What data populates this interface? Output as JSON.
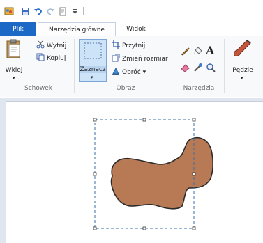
{
  "tabs": {
    "file": "Plik",
    "home": "Narzędzia główne",
    "view": "Widok"
  },
  "clipboard": {
    "paste": "Wklej",
    "cut": "Wytnij",
    "copy": "Kopiuj",
    "group": "Schowek"
  },
  "image": {
    "select": "Zaznacz",
    "crop": "Przytnij",
    "resize": "Zmień rozmiar",
    "rotate": "Obróć ▾",
    "group": "Obraz"
  },
  "tools": {
    "group": "Narzędzia",
    "text_glyph": "A"
  },
  "brushes": {
    "label": "Pędzle"
  },
  "colors": {
    "accent": "#1b68c7",
    "shape_fill": "#b87955",
    "shape_stroke": "#2b2b2b",
    "selection": "#3b6ea5"
  },
  "icons": [
    "app-icon",
    "save-icon",
    "undo-icon",
    "redo-icon",
    "customize-icon",
    "paste-icon",
    "cut-icon",
    "copy-icon",
    "select-icon",
    "crop-icon",
    "resize-icon",
    "rotate-icon",
    "pencil-icon",
    "fill-icon",
    "text-icon",
    "eraser-icon",
    "color-picker-icon",
    "magnifier-icon",
    "brushes-icon"
  ]
}
